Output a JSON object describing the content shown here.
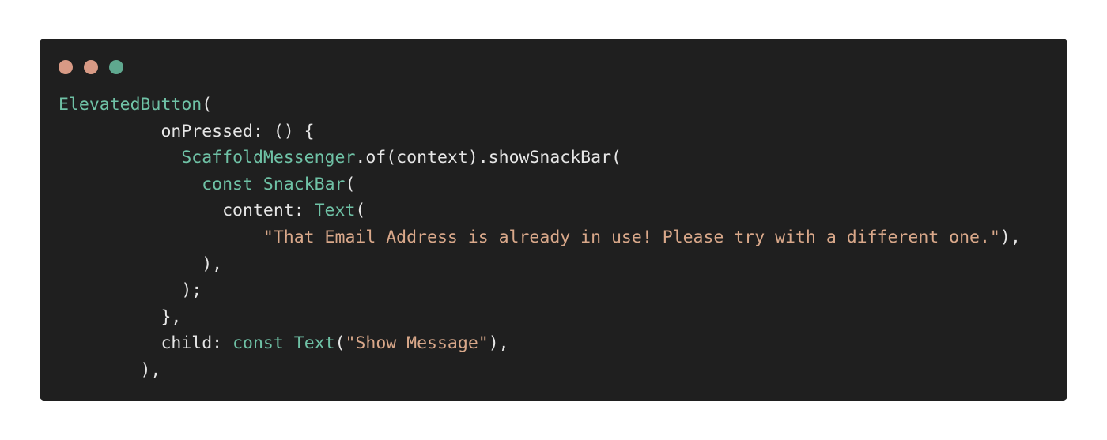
{
  "window": {
    "background": "#1f1f1f",
    "controls": [
      {
        "name": "close",
        "color": "#d89a85"
      },
      {
        "name": "minimize",
        "color": "#d89a85"
      },
      {
        "name": "zoom",
        "color": "#5fa88f"
      }
    ]
  },
  "code": {
    "colors": {
      "type": "#6fc2a6",
      "keyword": "#6fc2a6",
      "string": "#d9a88a",
      "plain": "#e6e6e6"
    },
    "lines": [
      [
        {
          "t": "ElevatedButton",
          "k": "type"
        },
        {
          "t": "(",
          "k": "plain"
        }
      ],
      [
        {
          "t": "          onPressed: () {",
          "k": "plain"
        }
      ],
      [
        {
          "t": "            ",
          "k": "plain"
        },
        {
          "t": "ScaffoldMessenger",
          "k": "type"
        },
        {
          "t": ".of(context).showSnackBar(",
          "k": "plain"
        }
      ],
      [
        {
          "t": "              ",
          "k": "plain"
        },
        {
          "t": "const",
          "k": "kw"
        },
        {
          "t": " ",
          "k": "plain"
        },
        {
          "t": "SnackBar",
          "k": "type"
        },
        {
          "t": "(",
          "k": "plain"
        }
      ],
      [
        {
          "t": "                content: ",
          "k": "plain"
        },
        {
          "t": "Text",
          "k": "type"
        },
        {
          "t": "(",
          "k": "plain"
        }
      ],
      [
        {
          "t": "                    ",
          "k": "plain"
        },
        {
          "t": "\"That Email Address is already in use! Please try with a different one.\"",
          "k": "str"
        },
        {
          "t": "),",
          "k": "plain"
        }
      ],
      [
        {
          "t": "              ),",
          "k": "plain"
        }
      ],
      [
        {
          "t": "            );",
          "k": "plain"
        }
      ],
      [
        {
          "t": "          },",
          "k": "plain"
        }
      ],
      [
        {
          "t": "          child: ",
          "k": "plain"
        },
        {
          "t": "const",
          "k": "kw"
        },
        {
          "t": " ",
          "k": "plain"
        },
        {
          "t": "Text",
          "k": "type"
        },
        {
          "t": "(",
          "k": "plain"
        },
        {
          "t": "\"Show Message\"",
          "k": "str"
        },
        {
          "t": "),",
          "k": "plain"
        }
      ],
      [
        {
          "t": "        ),",
          "k": "plain"
        }
      ]
    ]
  }
}
